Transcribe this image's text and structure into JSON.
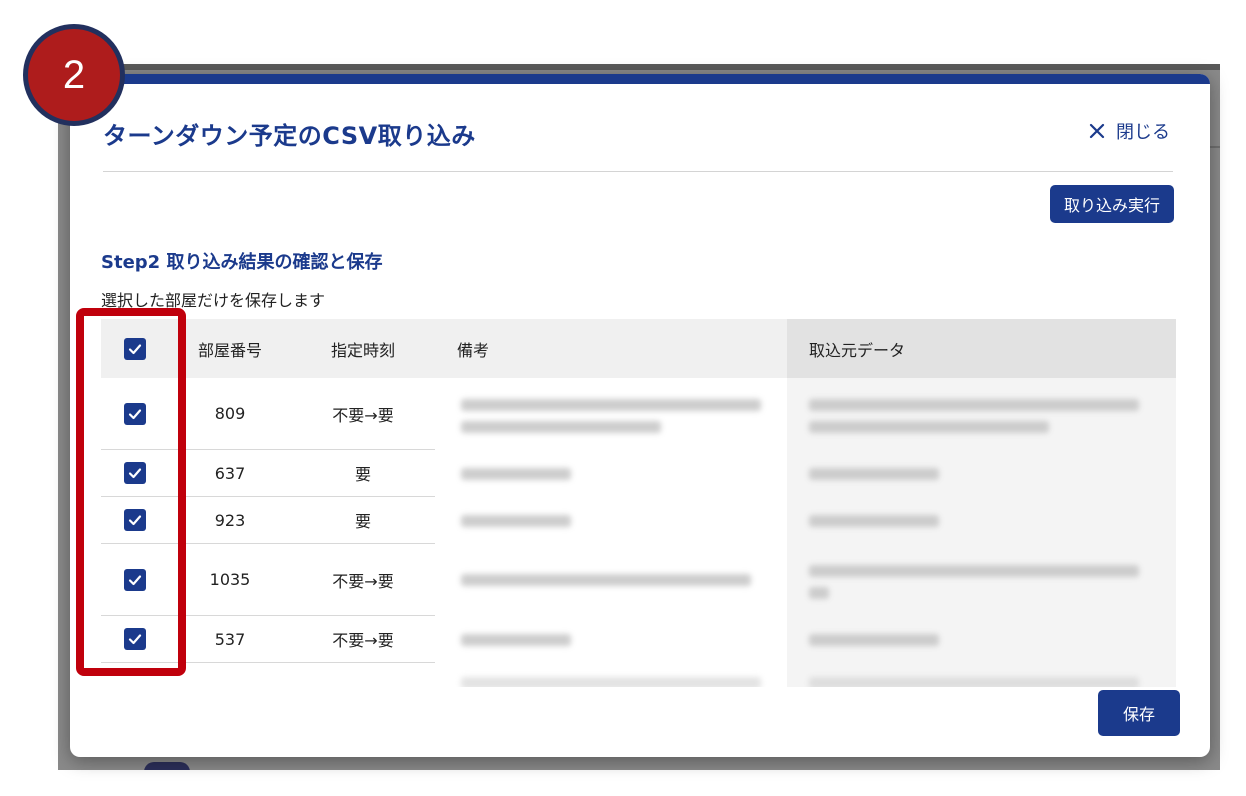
{
  "badge": {
    "number": "2"
  },
  "modal": {
    "title": "ターンダウン予定のCSV取り込み",
    "close_label": "閉じる",
    "import_button": "取り込み実行",
    "step_title": "Step2 取り込み結果の確認と保存",
    "step_description": "選択した部屋だけを保存します",
    "save_button": "保存"
  },
  "table": {
    "headers": {
      "room_number": "部屋番号",
      "specified_time": "指定時刻",
      "remarks": "備考",
      "source_data": "取込元データ"
    },
    "select_all_checked": true,
    "rows": [
      {
        "checked": true,
        "room": "809",
        "time": "不要→要"
      },
      {
        "checked": true,
        "room": "637",
        "time": "要"
      },
      {
        "checked": true,
        "room": "923",
        "time": "要"
      },
      {
        "checked": true,
        "room": "1035",
        "time": "不要→要"
      },
      {
        "checked": true,
        "room": "537",
        "time": "不要→要"
      }
    ]
  },
  "colors": {
    "accent": "#1b3a8c",
    "highlight": "#c0000c",
    "badge": "#ae1c1c"
  }
}
